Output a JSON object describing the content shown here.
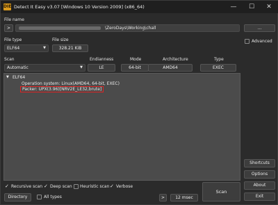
{
  "titlebar": {
    "app_icon": "DIE",
    "title": "Detect It Easy v3.07 [Windows 10 Version 2009] (x86_64)",
    "minimize_glyph": "—",
    "maximize_glyph": "☐",
    "close_glyph": "✕"
  },
  "file_name": {
    "label": "File name",
    "arrow_button": ">",
    "path": "\\ZeroDays\\Working\\chall",
    "browse_button": "..."
  },
  "advanced": {
    "label": "Advanced",
    "checked": false
  },
  "file_type": {
    "label": "File type",
    "value": "ELF64",
    "dropdown_icon": "chevron-down-icon"
  },
  "file_size": {
    "label": "File size",
    "value": "328.21 KiB"
  },
  "info": {
    "scan_label": "Scan",
    "scan_value": "Automatic",
    "endianness_label": "Endianness",
    "endianness_value": "LE",
    "mode_label": "Mode",
    "mode_value": "64-bit",
    "architecture_label": "Architecture",
    "architecture_value": "AMD64",
    "type_label": "Type",
    "type_value": "EXEC"
  },
  "result": {
    "root": "ELF64",
    "operation_system": "Operation system: Linux(AMD64, 64-bit, EXEC)",
    "packer": "Packer: UPX(3.96)[NRV2E_LE32,brute]",
    "highlight_color": "#e02424"
  },
  "side_buttons": {
    "shortcuts": "Shortcuts",
    "options": "Options",
    "about": "About",
    "exit": "Exit"
  },
  "options": {
    "recursive_scan": "Recursive scan",
    "deep_scan": "Deep scan",
    "heuristic_scan": "Heuristic scan",
    "verbose": "Verbose",
    "all_types": "All types"
  },
  "bottom": {
    "directory_button": "Directory",
    "arrow_button": ">",
    "elapsed": "12 msec",
    "scan_button": "Scan"
  }
}
